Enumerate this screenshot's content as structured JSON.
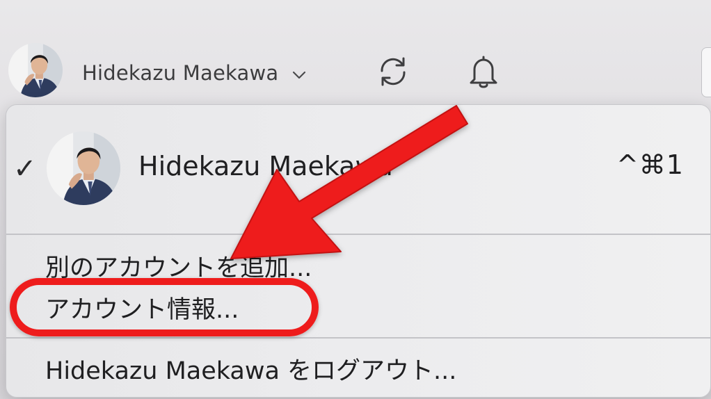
{
  "toolbar": {
    "account_name": "Hidekazu Maekawa",
    "avatar_icon": "user-avatar-photo",
    "dropdown_icon": "chevron-down-icon",
    "sync_icon": "sync-icon",
    "notifications_icon": "bell-icon"
  },
  "menu": {
    "account": {
      "checked": true,
      "name": "Hidekazu Maekawa",
      "shortcut": "^⌘1"
    },
    "items": [
      {
        "label": "別のアカウントを追加..."
      },
      {
        "label": "アカウント情報..."
      },
      {
        "label": "Hidekazu Maekawa をログアウト..."
      }
    ]
  },
  "annotation": {
    "color": "#ee1c1c",
    "highlighted_item": "アカウント情報..."
  }
}
